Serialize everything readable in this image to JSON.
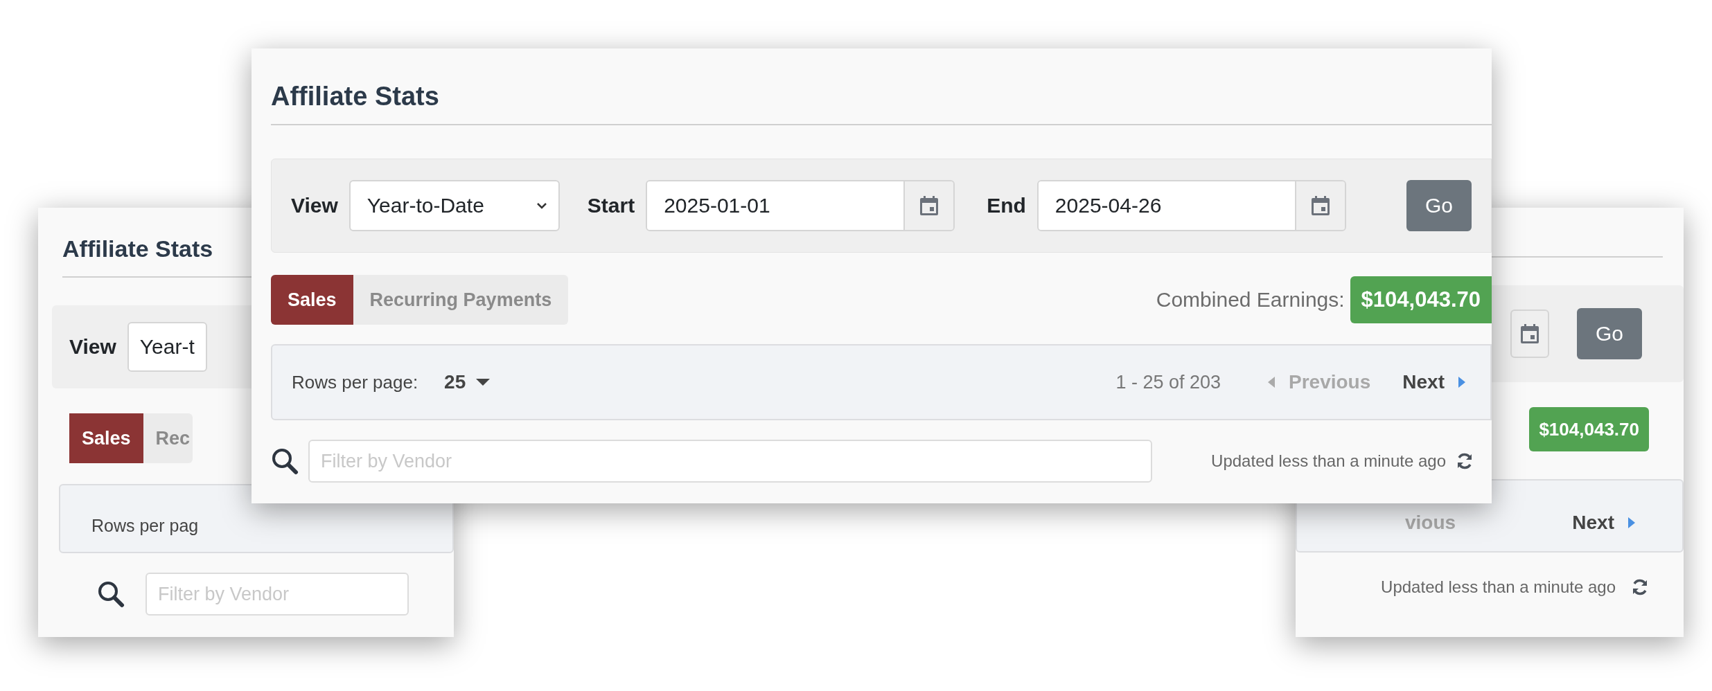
{
  "main": {
    "title": "Affiliate Stats",
    "filters": {
      "view": {
        "label": "View",
        "value": "Year-to-Date"
      },
      "start": {
        "label": "Start",
        "value": "2025-01-01"
      },
      "end": {
        "label": "End",
        "value": "2025-04-26"
      },
      "go": "Go"
    },
    "tabs": [
      {
        "label": "Sales",
        "selected": true
      },
      {
        "label": "Recurring Payments",
        "selected": false
      }
    ],
    "earnings": {
      "label": "Combined Earnings:",
      "value": "$104,043.70"
    },
    "pager": {
      "rows_label": "Rows per page:",
      "rows_value": "25",
      "range": "1 - 25 of 203",
      "previous": {
        "label": "Previous",
        "disabled": true
      },
      "next": {
        "label": "Next",
        "disabled": false
      }
    },
    "search": {
      "placeholder": "Filter by Vendor"
    },
    "updated": "Updated less than a minute ago"
  },
  "back_left": {
    "title": "Affiliate Stats",
    "view_label": "View",
    "view_value": "Year-t",
    "tabs": [
      {
        "label": "Sales",
        "selected": true
      },
      {
        "label": "Rec",
        "selected": false
      }
    ],
    "rows_label": "Rows per pag",
    "search": {
      "placeholder": "Filter by Vendor"
    }
  },
  "back_right": {
    "go": "Go",
    "earnings": "$104,043.70",
    "previous": {
      "label": "vious",
      "disabled": true
    },
    "next": {
      "label": "Next",
      "disabled": false
    },
    "updated": "Updated less than a minute ago"
  }
}
